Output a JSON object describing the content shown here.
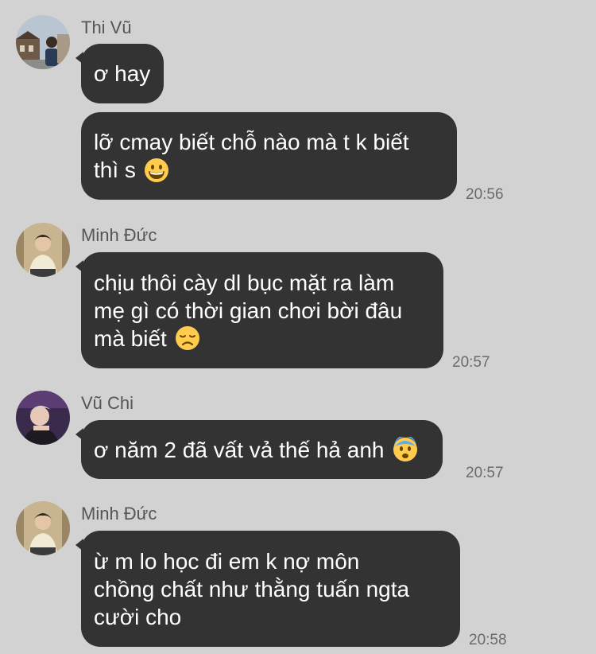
{
  "messages": [
    {
      "sender": "Thi Vũ",
      "bubbles": [
        {
          "lines": [
            "ơ hay"
          ]
        },
        {
          "lines": [
            "lỡ cmay biết chỗ nào mà t k biết",
            "thì s"
          ],
          "emoji": "grinning-face-emoji",
          "time": "20:56"
        }
      ]
    },
    {
      "sender": "Minh Đức",
      "bubbles": [
        {
          "lines": [
            "chịu thôi cày dl bục mặt ra làm",
            "mẹ gì có thời gian chơi bời đâu",
            "mà biết"
          ],
          "emoji": "disappointed-face-emoji",
          "time": "20:57"
        }
      ]
    },
    {
      "sender": "Vũ Chi",
      "bubbles": [
        {
          "lines": [
            "ơ năm 2 đã vất vả thế hả anh"
          ],
          "emoji": "fearful-face-emoji",
          "time": "20:57"
        }
      ]
    },
    {
      "sender": "Minh Đức",
      "bubbles": [
        {
          "lines": [
            "ừ m lo học đi em k nợ môn",
            "chồng chất như thằng tuấn ngta",
            "cười cho"
          ],
          "time": "20:58"
        }
      ]
    }
  ],
  "colors": {
    "background": "#d2d2d2",
    "bubble": "#333333",
    "bubble_text": "#ffffff",
    "sender_text": "#555555",
    "time_text": "#6b6b6b",
    "emoji_face": "#ffcc4d"
  }
}
